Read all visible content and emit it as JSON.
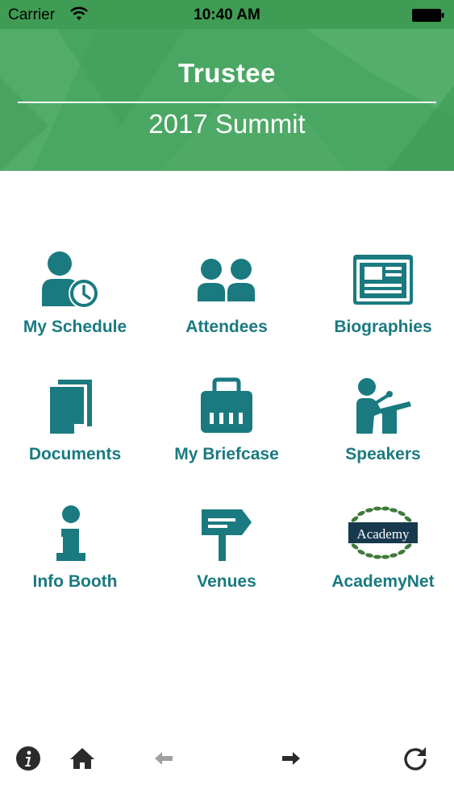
{
  "status_bar": {
    "carrier": "Carrier",
    "time": "10:40 AM"
  },
  "header": {
    "title": "Trustee",
    "subtitle": "2017 Summit"
  },
  "menu": {
    "items": [
      {
        "label": "My Schedule",
        "icon": "person-clock-icon"
      },
      {
        "label": "Attendees",
        "icon": "people-icon"
      },
      {
        "label": "Biographies",
        "icon": "newspaper-icon"
      },
      {
        "label": "Documents",
        "icon": "documents-icon"
      },
      {
        "label": "My Briefcase",
        "icon": "briefcase-icon"
      },
      {
        "label": "Speakers",
        "icon": "speaker-podium-icon"
      },
      {
        "label": "Info Booth",
        "icon": "info-icon"
      },
      {
        "label": "Venues",
        "icon": "signpost-icon"
      },
      {
        "label": "AcademyNet",
        "icon": "academy-logo-icon",
        "logo_text": "Academy"
      }
    ]
  },
  "toolbar": {
    "icons": [
      "info-icon",
      "home-icon",
      "back-arrow-icon",
      "forward-arrow-icon",
      "refresh-icon"
    ]
  },
  "colors": {
    "brand_green": "#4aa663",
    "icon_teal": "#1a7a80",
    "logo_navy": "#17394e"
  }
}
